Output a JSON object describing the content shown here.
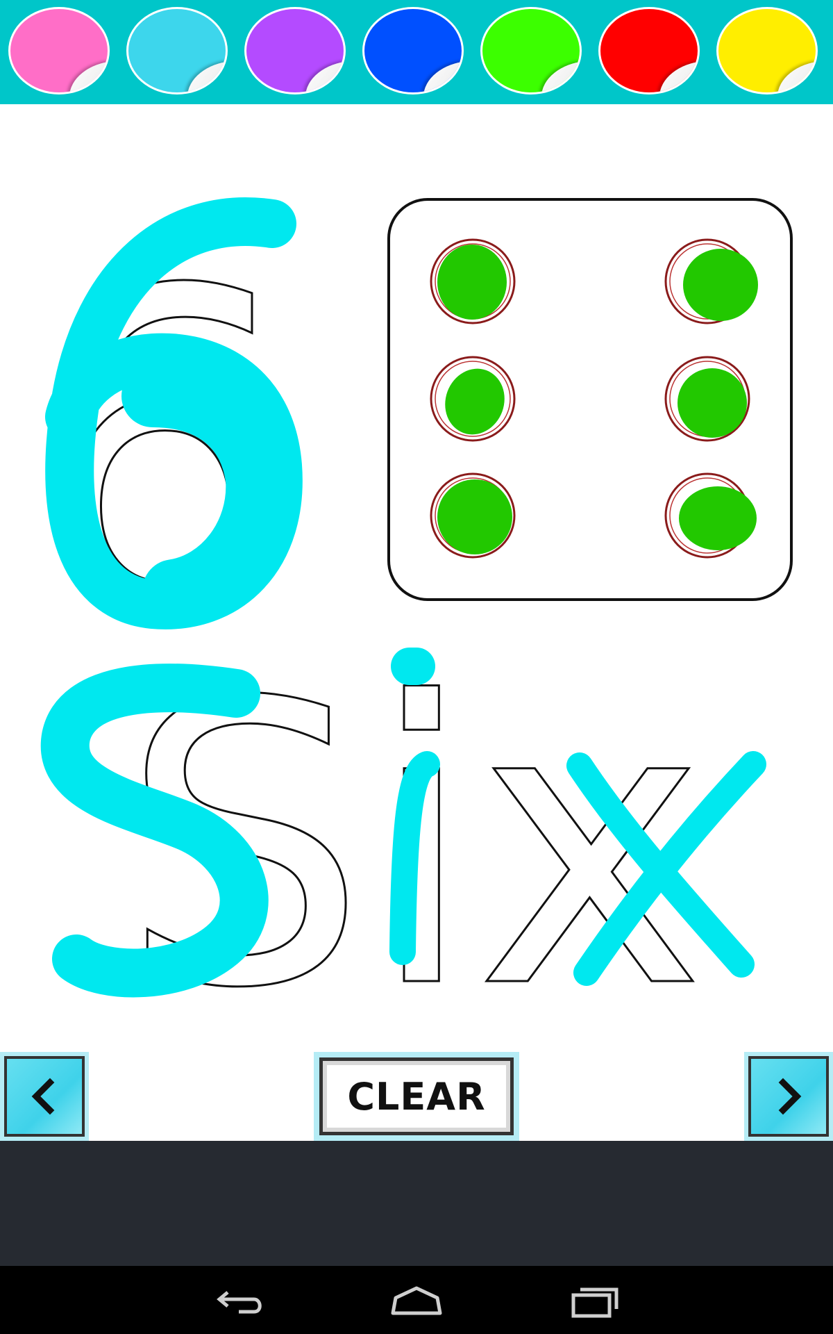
{
  "palette": {
    "colors": [
      {
        "name": "pink",
        "hex": "#ff6ec7"
      },
      {
        "name": "light-blue",
        "hex": "#3dd6ec"
      },
      {
        "name": "purple",
        "hex": "#b44bff"
      },
      {
        "name": "blue",
        "hex": "#0050ff"
      },
      {
        "name": "green",
        "hex": "#3cff00"
      },
      {
        "name": "red",
        "hex": "#ff0000"
      },
      {
        "name": "yellow",
        "hex": "#ffee00"
      }
    ]
  },
  "activity": {
    "numeral": "6",
    "word": "Six",
    "dot_count": 6,
    "stroke_color": "#00e8ef",
    "dot_fill_color": "#22c800"
  },
  "controls": {
    "clear_label": "CLEAR",
    "prev_icon": "chevron-left-icon",
    "next_icon": "chevron-right-icon"
  },
  "system_nav": {
    "icons": [
      "back-icon",
      "home-icon",
      "recents-icon"
    ]
  }
}
